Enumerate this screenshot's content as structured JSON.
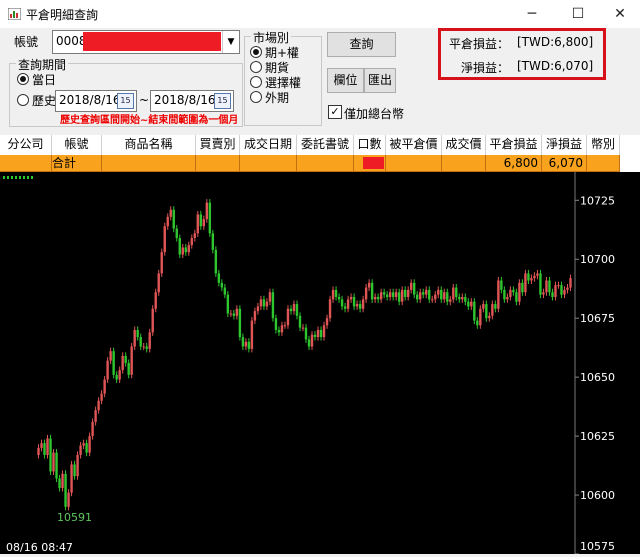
{
  "window": {
    "title": "平倉明細查詢",
    "minimize": "─",
    "maximize": "☐",
    "close": "✕"
  },
  "form": {
    "account_label": "帳號",
    "account_value": "0008",
    "period_group": "查詢期間",
    "today_label": "當日",
    "history_label": "歷史",
    "date_from": "2018/8/16",
    "date_to": "2018/8/16",
    "date_sep": "~",
    "calendar_day": "15",
    "history_note": "歷史查詢區間開始~結束間範圍為一個月",
    "market_group": "市場別",
    "markets": [
      "期+權",
      "期貨",
      "選擇權",
      "外期"
    ],
    "query_button": "查詢",
    "columns_button": "欄位",
    "export_button": "匯出",
    "twd_only_label": "僅加總台幣",
    "twd_only_checked": true
  },
  "pl": {
    "close_label": "平倉損益：",
    "close_value": "[TWD:6,800]",
    "net_label": "淨損益：",
    "net_value": "[TWD:6,070]"
  },
  "table": {
    "headers": [
      "分公司",
      "帳號",
      "商品名稱",
      "買賣別",
      "成交日期",
      "委託書號",
      "口數",
      "被平倉價",
      "成交價",
      "平倉損益",
      "淨損益",
      "幣別"
    ],
    "total_row": [
      "",
      "合計",
      "",
      "",
      "",
      "",
      "",
      "",
      "",
      "6,800",
      "6,070",
      ""
    ]
  },
  "colors": {
    "up": "#e05555",
    "down": "#2ec62e",
    "redact": "#ee1c25",
    "highlight_row": "#f8a21e"
  },
  "chart_data": {
    "type": "candlestick",
    "ylim": [
      10575,
      10737
    ],
    "yticks": [
      10575,
      10600,
      10625,
      10650,
      10675,
      10700,
      10725
    ],
    "min_label": "10591",
    "time_label": "08/16 08:47",
    "close_series": [
      10620,
      10622,
      10617,
      10624,
      10610,
      10618,
      10607,
      10603,
      10609,
      10595,
      10601,
      10613,
      10608,
      10617,
      10621,
      10622,
      10618,
      10625,
      10631,
      10636,
      10640,
      10643,
      10649,
      10657,
      10661,
      10651,
      10649,
      10653,
      10659,
      10656,
      10651,
      10663,
      10670,
      10667,
      10663,
      10663,
      10662,
      10669,
      10679,
      10686,
      10694,
      10703,
      10714,
      10718,
      10721,
      10713,
      10709,
      10702,
      10705,
      10703,
      10706,
      10709,
      10711,
      10719,
      10714,
      10717,
      10724,
      10711,
      10704,
      10694,
      10690,
      10688,
      10685,
      10677,
      10677,
      10676,
      10679,
      10667,
      10663,
      10665,
      10662,
      10674,
      10678,
      10680,
      10683,
      10680,
      10682,
      10686,
      10675,
      10670,
      10669,
      10672,
      10672,
      10679,
      10678,
      10681,
      10676,
      10671,
      10671,
      10666,
      10663,
      10668,
      10667,
      10670,
      10667,
      10672,
      10675,
      10683,
      10687,
      10684,
      10683,
      10680,
      10679,
      10683,
      10684,
      10680,
      10681,
      10679,
      10683,
      10688,
      10690,
      10683,
      10684,
      10683,
      10686,
      10685,
      10684,
      10686,
      10684,
      10686,
      10682,
      10687,
      10684,
      10687,
      10690,
      10685,
      10683,
      10686,
      10685,
      10687,
      10683,
      10683,
      10685,
      10687,
      10683,
      10686,
      10682,
      10683,
      10688,
      10684,
      10683,
      10684,
      10682,
      10680,
      10682,
      10674,
      10672,
      10679,
      10681,
      10675,
      10676,
      10681,
      10679,
      10691,
      10687,
      10683,
      10684,
      10687,
      10686,
      10682,
      10690,
      10686,
      10694,
      10691,
      10692,
      10693,
      10694,
      10685,
      10686,
      10691,
      10686,
      10684,
      10689,
      10689,
      10685,
      10687,
      10688,
      10692
    ]
  }
}
